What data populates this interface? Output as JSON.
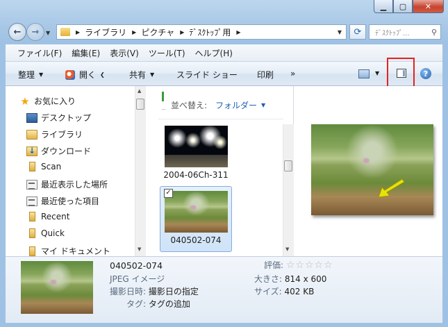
{
  "address": {
    "crumbs": [
      "ライブラリ",
      "ピクチャ",
      "ﾃﾞｽｸﾄｯﾌﾟ用"
    ]
  },
  "search": {
    "placeholder": "ﾃﾞｽｸﾄｯﾌﾟ..."
  },
  "menu": [
    "ファイル(F)",
    "編集(E)",
    "表示(V)",
    "ツール(T)",
    "ヘルプ(H)"
  ],
  "commands": {
    "organize": "整理",
    "open": "開く",
    "share": "共有",
    "slideshow": "スライド ショー",
    "print": "印刷",
    "more": "»"
  },
  "nav": {
    "favorites": "お気に入り",
    "items": [
      "デスクトップ",
      "ライブラリ",
      "ダウンロード",
      "Scan",
      "最近表示した場所",
      "最近使った項目",
      "Recent",
      "Quick",
      "マイ ドキュメント"
    ]
  },
  "files": {
    "sort_label": "並べ替え:",
    "sort_value": "フォルダー",
    "items": [
      {
        "name": "2004-06Ch-311"
      },
      {
        "name": "040502-074"
      }
    ]
  },
  "details": {
    "filename": "040502-074",
    "filetype": "JPEG イメージ",
    "date_label": "撮影日時:",
    "date_value": "撮影日の指定",
    "tag_label": "タグ:",
    "tag_value": "タグの追加",
    "rating_label": "評価:",
    "rating_stars": "☆☆☆☆☆",
    "size_label": "大きさ:",
    "size_value": "814 x 600",
    "filesize_label": "サイズ:",
    "filesize_value": "402 KB"
  },
  "colors": {
    "highlight": "#e8201f",
    "arrow": "#e6e20c",
    "accent": "#1e5fb0"
  }
}
